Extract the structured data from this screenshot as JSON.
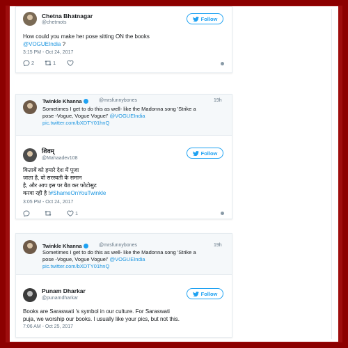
{
  "tweet1": {
    "name": "Chetna Bhatnagar",
    "handle": "@chetmots",
    "follow": "Follow",
    "text_line1": "How could you make her pose sitting ON the books",
    "mention": "@VOGUEIndia",
    "text_tail": " ?",
    "timestamp": "3:15 PM - Oct 24, 2017",
    "replies": "2",
    "retweets": "1",
    "likes": ""
  },
  "quote1": {
    "name": "Twinkle Khanna",
    "handle": "@mrsfunnybones",
    "age": "19h",
    "line1": "Sometimes I get to do this as well- like the Madonna song 'Strike a",
    "line2_prefix": "pose -Vogue, Vogue Vogue!' ",
    "line2_mention": "@VOGUEIndia",
    "line3": "pic.twitter.com/bXDTY01hnQ"
  },
  "tweet2": {
    "name": "शिवम्",
    "handle": "@Mahaadev108",
    "follow": "Follow",
    "line1": "किताबें को हमारे देश में पूजा",
    "line2": "जाता है, वो सरस्वती के समान",
    "line3": "है, और आप इस पर बैठ कर फोटोसुट",
    "line4_prefix": "करवा रही है !",
    "line4_hashtag": "#ShameOnYouTwinkle",
    "timestamp": "3:05 PM - Oct 24, 2017",
    "replies": "",
    "retweets": "",
    "likes": "1"
  },
  "quote2": {
    "name": "Twinkle Khanna",
    "handle": "@mrsfunnybones",
    "age": "19h",
    "line1": "Sometimes I get to do this as well- like the Madonna song 'Strike a",
    "line2_prefix": "pose -Vogue, Vogue Vogue!' ",
    "line2_mention": "@VOGUEIndia",
    "line3": "pic.twitter.com/bXDTY01hnQ"
  },
  "tweet3": {
    "name": "Punam Dharkar",
    "handle": "@punamdharkar",
    "follow": "Follow",
    "line1": "Books are Saraswati 's symbol in our culture. For Saraswati",
    "line2": "puja, we worship our books. I usually like your pics, but not this.",
    "timestamp": "7:06 AM - Oct 25, 2017"
  },
  "colors": {
    "frame": "#8c0000",
    "link": "#1b95e0",
    "accent": "#1da1f2"
  }
}
